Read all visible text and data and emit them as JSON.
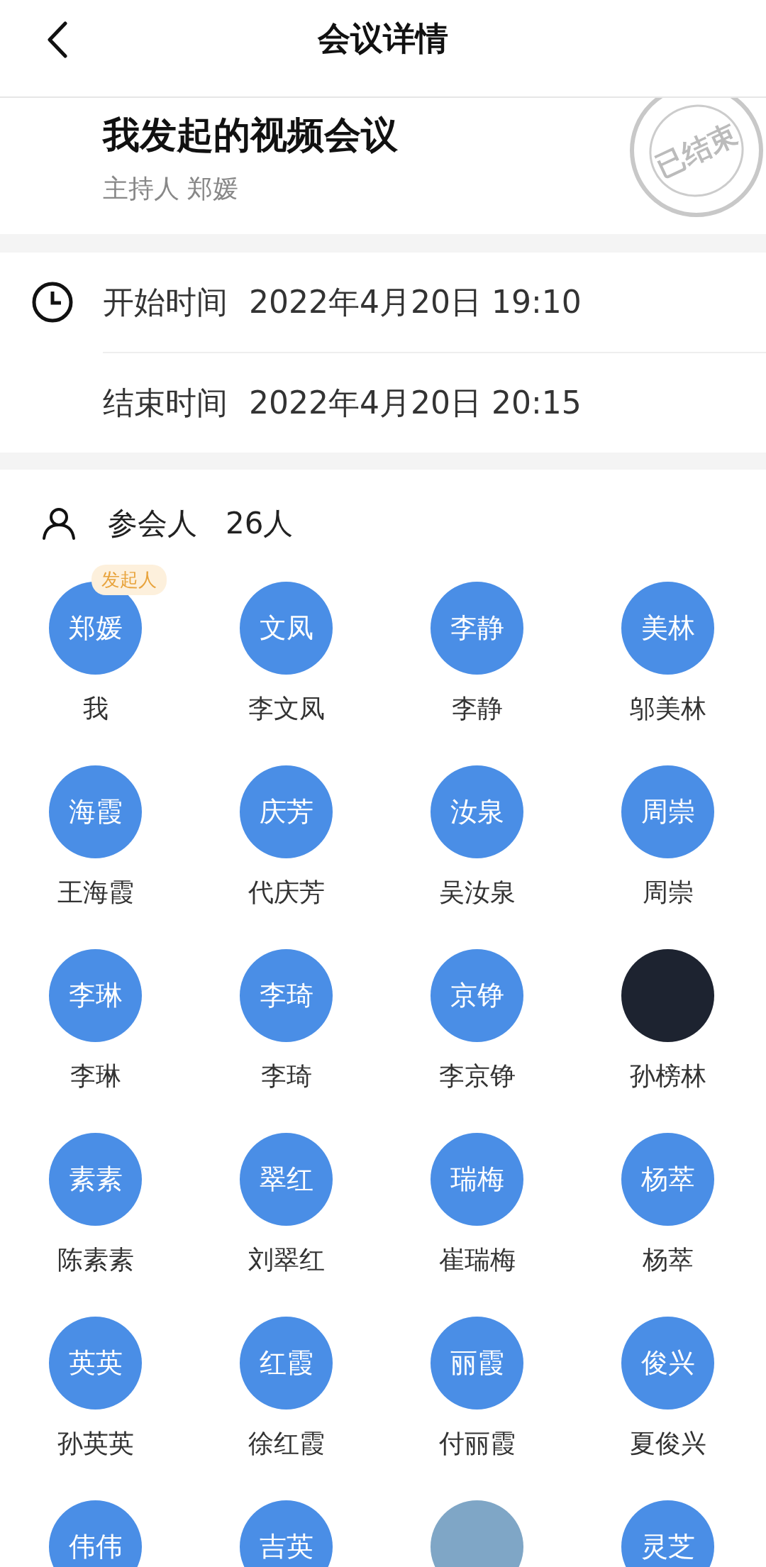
{
  "header": {
    "title": "会议详情"
  },
  "meeting": {
    "title": "我发起的视频会议",
    "host": "主持人 郑媛",
    "stamp": "已结束"
  },
  "times": [
    {
      "label": "开始时间",
      "value": "2022年4月20日 19:10"
    },
    {
      "label": "结束时间",
      "value": "2022年4月20日 20:15"
    }
  ],
  "participants_header": {
    "label": "参会人",
    "count": "26人"
  },
  "participants": [
    {
      "kind": "initials",
      "avatar": "郑媛",
      "name": "我",
      "badge": "发起人"
    },
    {
      "kind": "initials",
      "avatar": "文凤",
      "name": "李文凤"
    },
    {
      "kind": "initials",
      "avatar": "李静",
      "name": "李静"
    },
    {
      "kind": "initials",
      "avatar": "美林",
      "name": "邬美林"
    },
    {
      "kind": "initials",
      "avatar": "海霞",
      "name": "王海霞"
    },
    {
      "kind": "initials",
      "avatar": "庆芳",
      "name": "代庆芳"
    },
    {
      "kind": "initials",
      "avatar": "汝泉",
      "name": "吴汝泉"
    },
    {
      "kind": "initials",
      "avatar": "周崇",
      "name": "周崇"
    },
    {
      "kind": "initials",
      "avatar": "李琳",
      "name": "李琳"
    },
    {
      "kind": "initials",
      "avatar": "李琦",
      "name": "李琦"
    },
    {
      "kind": "initials",
      "avatar": "京铮",
      "name": "李京铮"
    },
    {
      "kind": "photo",
      "name": "孙榜林"
    },
    {
      "kind": "initials",
      "avatar": "素素",
      "name": "陈素素"
    },
    {
      "kind": "initials",
      "avatar": "翠红",
      "name": "刘翠红"
    },
    {
      "kind": "initials",
      "avatar": "瑞梅",
      "name": "崔瑞梅"
    },
    {
      "kind": "initials",
      "avatar": "杨萃",
      "name": "杨萃"
    },
    {
      "kind": "initials",
      "avatar": "英英",
      "name": "孙英英"
    },
    {
      "kind": "initials",
      "avatar": "红霞",
      "name": "徐红霞"
    },
    {
      "kind": "initials",
      "avatar": "丽霞",
      "name": "付丽霞"
    },
    {
      "kind": "initials",
      "avatar": "俊兴",
      "name": "夏俊兴"
    },
    {
      "kind": "initials",
      "avatar": "伟伟"
    },
    {
      "kind": "initials",
      "avatar": "吉英"
    },
    {
      "kind": "photo"
    },
    {
      "kind": "initials",
      "avatar": "灵芝"
    }
  ]
}
